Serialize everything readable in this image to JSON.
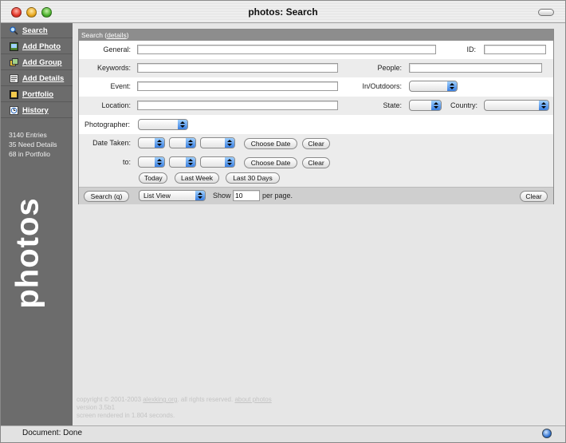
{
  "window": {
    "title": "photos: Search"
  },
  "sidebar": {
    "items": [
      {
        "label": "Search",
        "icon": "search-icon"
      },
      {
        "label": "Add Photo",
        "icon": "add-photo-icon"
      },
      {
        "label": "Add Group",
        "icon": "add-group-icon"
      },
      {
        "label": "Add Details",
        "icon": "add-details-icon"
      },
      {
        "label": "Portfolio",
        "icon": "portfolio-icon"
      },
      {
        "label": "History",
        "icon": "history-icon"
      }
    ],
    "stats": [
      "3140 Entries",
      "35 Need Details",
      "68 in Portfolio"
    ],
    "brand": "photos"
  },
  "search": {
    "header_prefix": "Search (",
    "header_link": "details",
    "header_suffix": ")",
    "labels": {
      "general": "General:",
      "id": "ID:",
      "keywords": "Keywords:",
      "people": "People:",
      "event": "Event:",
      "in_outdoors": "In/Outdoors:",
      "location": "Location:",
      "state": "State:",
      "country": "Country:",
      "photographer": "Photographer:",
      "date_taken": "Date Taken:",
      "to": "to:",
      "show": "Show",
      "per_page": "per page."
    },
    "values": {
      "general": "",
      "id": "",
      "keywords": "",
      "people": "",
      "event": "",
      "location": "",
      "show_count": "10",
      "view": "List View"
    },
    "buttons": {
      "choose_date": "Choose Date",
      "clear": "Clear",
      "today": "Today",
      "last_week": "Last Week",
      "last_30_days": "Last 30 Days",
      "search": "Search (q)"
    }
  },
  "footer": {
    "copyright_prefix": "copyright © 2001-2003 ",
    "site_link": "alexking.org",
    "rights": ". all rights reserved. ",
    "about_link": "about photos",
    "version": "version 3.5b1",
    "rendered": "screen rendered in 1.804 seconds."
  },
  "status": {
    "text": "Document: Done"
  },
  "colors": {
    "sidebar": "#6c6c6c",
    "panel_header": "#8d8d8d",
    "select_accent": "#3a7fe0"
  }
}
